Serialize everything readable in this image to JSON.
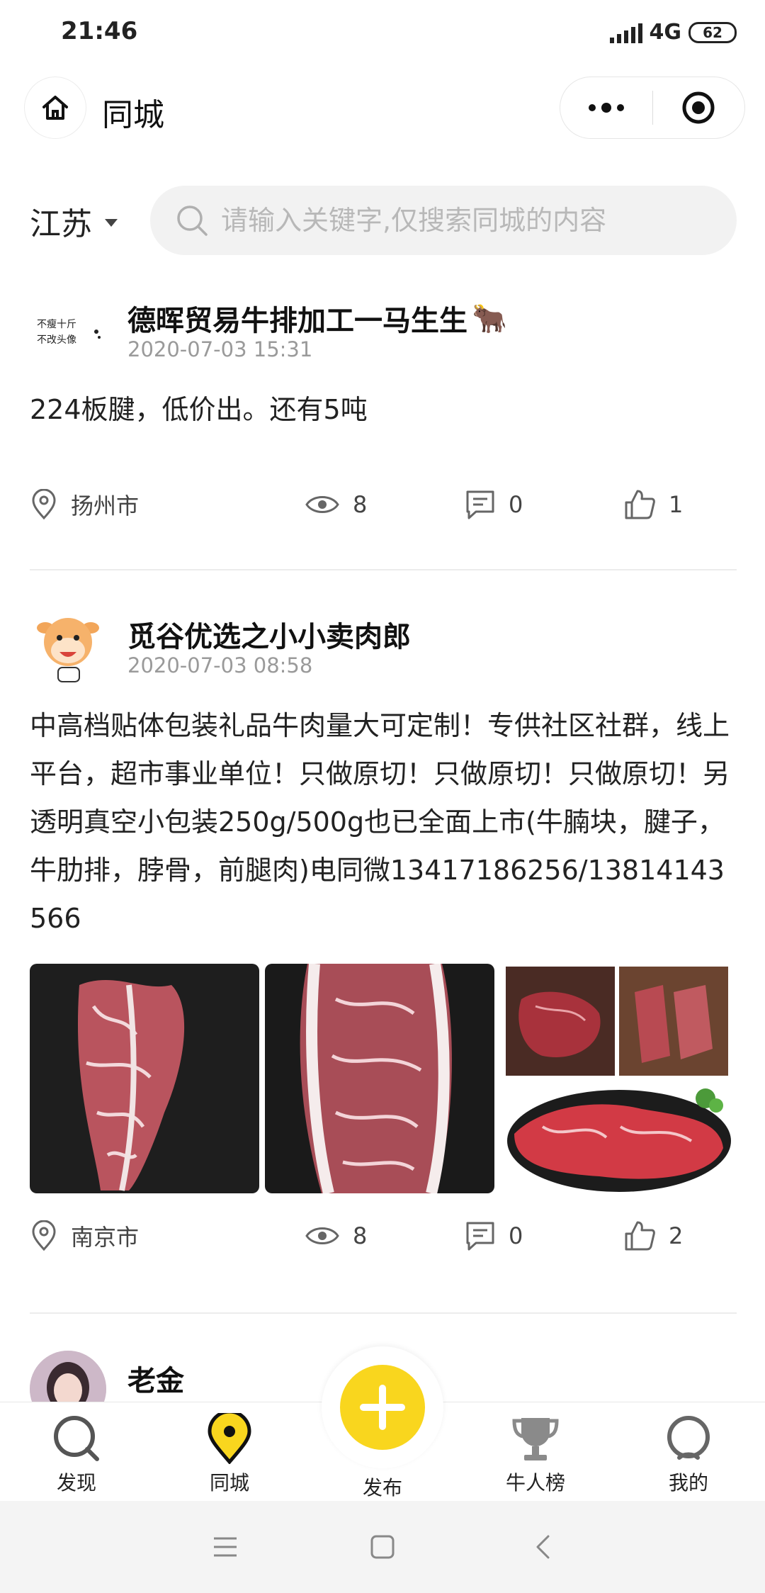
{
  "status_bar": {
    "time": "21:46",
    "network": "4G",
    "battery": "62"
  },
  "nav": {
    "title": "同城"
  },
  "search": {
    "region": "江苏",
    "placeholder": "请输入关键字,仅搜索同城的内容"
  },
  "posts": [
    {
      "author": "德晖贸易牛排加工一马生生",
      "author_emoji": "🐂",
      "avatar_text": [
        "不瘦十斤",
        "不改头像"
      ],
      "time": "2020-07-03 15:31",
      "text": "224板腱，低价出。还有5吨",
      "location": "扬州市",
      "views": "8",
      "comments": "0",
      "likes": "1"
    },
    {
      "author": "觅谷优选之小小卖肉郎",
      "time": "2020-07-03 08:58",
      "text": "中高档贴体包装礼品牛肉量大可定制！专供社区社群，线上平台，超市事业单位！只做原切！只做原切！只做原切！另透明真空小包装250g/500g也已全面上市(牛腩块，腱子，牛肋排，脖骨，前腿肉)电同微13417186256/13814143566",
      "location": "南京市",
      "views": "8",
      "comments": "0",
      "likes": "2"
    },
    {
      "author": "老金"
    }
  ],
  "tabs": [
    {
      "label": "发现",
      "icon": "discover-icon"
    },
    {
      "label": "同城",
      "icon": "location-pin-icon"
    },
    {
      "label": "发布",
      "icon": "plus-icon"
    },
    {
      "label": "牛人榜",
      "icon": "trophy-icon"
    },
    {
      "label": "我的",
      "icon": "profile-icon"
    }
  ],
  "colors": {
    "accent": "#f9d61e",
    "text": "#222222",
    "muted": "#9a9a9a"
  }
}
